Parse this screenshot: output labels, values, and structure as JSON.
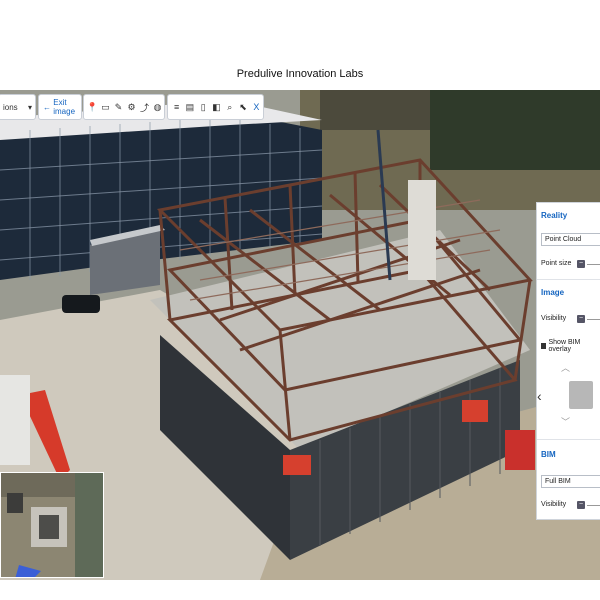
{
  "page": {
    "title": "Predulive Innovation Labs"
  },
  "toolbar": {
    "select_label": "ions",
    "exit_label": "Exit image",
    "close_label": "X",
    "tools": [
      "location-pin-icon",
      "camera-device-icon",
      "pencil-icon",
      "image-settings-icon",
      "share-icon",
      "globe-icon"
    ],
    "tools2": [
      "filter-lines-icon",
      "layers-icon",
      "document-icon",
      "ruler-icon",
      "search-icon",
      "cursor-select-icon",
      "close-icon"
    ]
  },
  "panel": {
    "reality_heading": "Reality",
    "reality_value": "Point Cloud",
    "point_size_label": "Point size",
    "image_heading": "Image",
    "visibility_label": "Visibility",
    "bim_overlay_label": "Show BIM overlay",
    "bim_heading": "BIM",
    "bim_value": "Full BIM",
    "bim_visibility_label": "Visibility"
  },
  "colors": {
    "accent": "#1565c0",
    "steel": "#6b3e2e",
    "panel_wall": "#3a3f44"
  }
}
